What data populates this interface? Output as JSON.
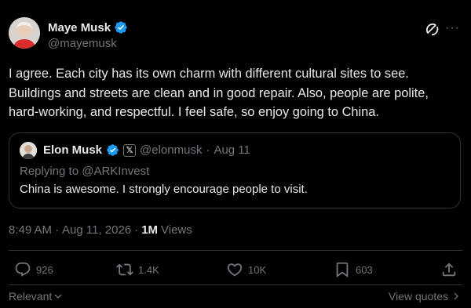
{
  "author": {
    "name": "Maye Musk",
    "handle": "@mayemusk",
    "verified_color": "#1d9bf0"
  },
  "tweet_text": "I agree. Each city has its own charm with different cultural sites to see. Buildings and streets are clean and in good repair. Also, people are polite, hard-working, and respectful. I feel safe, so enjoy going to China.",
  "quote": {
    "name": "Elon Musk",
    "affiliate_badge": "𝕏",
    "handle": "@elonmusk",
    "separator": "·",
    "date": "Aug 11",
    "replying_to": "Replying to @ARKInvest",
    "text": "China is awesome. I strongly encourage people to visit."
  },
  "meta": {
    "time": "8:49 AM",
    "separator": "·",
    "date": "Aug 11, 2026",
    "views_count": "1M",
    "views_label": "Views"
  },
  "actions": {
    "replies": "926",
    "reposts": "1.4K",
    "likes": "10K",
    "bookmarks": "603"
  },
  "footer": {
    "sort_label": "Relevant",
    "view_quotes": "View quotes"
  },
  "more_icon": "···",
  "colors": {
    "background": "#000000",
    "text": "#e7e9ea",
    "muted": "#71767b",
    "border": "#2f3336",
    "accent": "#1d9bf0"
  }
}
